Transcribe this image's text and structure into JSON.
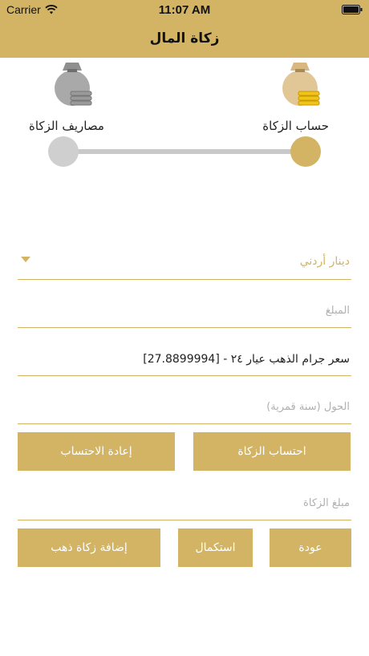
{
  "status_bar": {
    "carrier": "Carrier",
    "time": "11:07 AM"
  },
  "header": {
    "title": "زكاة المال"
  },
  "steps": {
    "left_label": "مصاريف الزكاة",
    "right_label": "حساب الزكاة",
    "left_icon": "money-bag-gray-icon",
    "right_icon": "money-bag-gold-icon",
    "active_step": "حساب الزكاة"
  },
  "form": {
    "currency": "دينار أردني",
    "amount_placeholder": "المبلغ",
    "gold_price": "[27.8899994] - سعر جرام الذهب عيار ٢٤",
    "year_placeholder": "الحول (سنة قمرية)",
    "zakat_amount_placeholder": "مبلغ الزكاة"
  },
  "buttons": {
    "calculate": "احتساب الزكاة",
    "reset": "إعادة الاحتساب",
    "back": "عودة",
    "complete": "استكمال",
    "add_gold": "إضافة زكاة ذهب"
  },
  "colors": {
    "accent": "#d2b464",
    "inactive": "#c9c9c9"
  }
}
